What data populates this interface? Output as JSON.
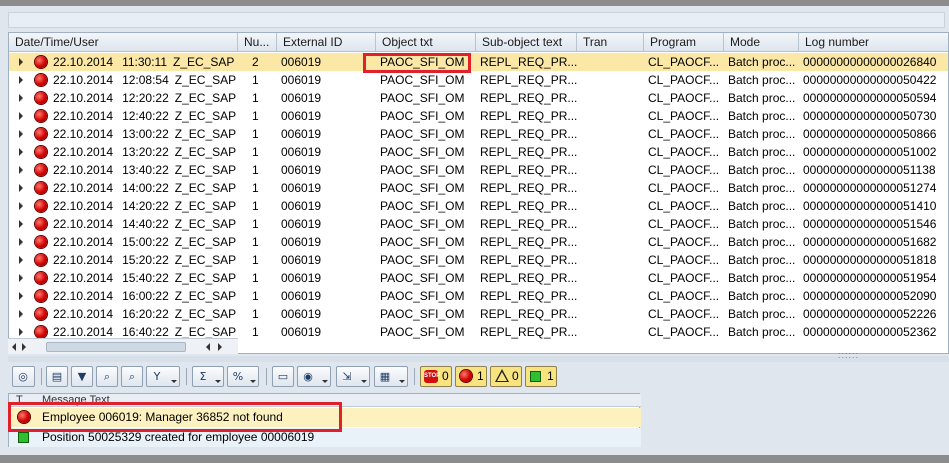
{
  "columns": {
    "datetime": "Date/Time/User",
    "num": "Nu...",
    "extid": "External ID",
    "objtxt": "Object txt",
    "subobj": "Sub-object text",
    "tran": "Tran",
    "program": "Program",
    "mode": "Mode",
    "lognum": "Log number"
  },
  "rows": [
    {
      "date": "22.10.2014",
      "time": "11:30:11",
      "user": "Z_EC_SAP",
      "num": "2",
      "extid": "006019",
      "objtxt": "PAOC_SFI_OM",
      "subobj": "REPL_REQ_PR...",
      "tran": "",
      "program": "CL_PAOCF...",
      "mode": "Batch proc...",
      "lognum": "00000000000000026840"
    },
    {
      "date": "22.10.2014",
      "time": "12:08:54",
      "user": "Z_EC_SAP",
      "num": "1",
      "extid": "006019",
      "objtxt": "PAOC_SFI_OM",
      "subobj": "REPL_REQ_PR...",
      "tran": "",
      "program": "CL_PAOCF...",
      "mode": "Batch proc...",
      "lognum": "00000000000000050422"
    },
    {
      "date": "22.10.2014",
      "time": "12:20:22",
      "user": "Z_EC_SAP",
      "num": "1",
      "extid": "006019",
      "objtxt": "PAOC_SFI_OM",
      "subobj": "REPL_REQ_PR...",
      "tran": "",
      "program": "CL_PAOCF...",
      "mode": "Batch proc...",
      "lognum": "00000000000000050594"
    },
    {
      "date": "22.10.2014",
      "time": "12:40:22",
      "user": "Z_EC_SAP",
      "num": "1",
      "extid": "006019",
      "objtxt": "PAOC_SFI_OM",
      "subobj": "REPL_REQ_PR...",
      "tran": "",
      "program": "CL_PAOCF...",
      "mode": "Batch proc...",
      "lognum": "00000000000000050730"
    },
    {
      "date": "22.10.2014",
      "time": "13:00:22",
      "user": "Z_EC_SAP",
      "num": "1",
      "extid": "006019",
      "objtxt": "PAOC_SFI_OM",
      "subobj": "REPL_REQ_PR...",
      "tran": "",
      "program": "CL_PAOCF...",
      "mode": "Batch proc...",
      "lognum": "00000000000000050866"
    },
    {
      "date": "22.10.2014",
      "time": "13:20:22",
      "user": "Z_EC_SAP",
      "num": "1",
      "extid": "006019",
      "objtxt": "PAOC_SFI_OM",
      "subobj": "REPL_REQ_PR...",
      "tran": "",
      "program": "CL_PAOCF...",
      "mode": "Batch proc...",
      "lognum": "00000000000000051002"
    },
    {
      "date": "22.10.2014",
      "time": "13:40:22",
      "user": "Z_EC_SAP",
      "num": "1",
      "extid": "006019",
      "objtxt": "PAOC_SFI_OM",
      "subobj": "REPL_REQ_PR...",
      "tran": "",
      "program": "CL_PAOCF...",
      "mode": "Batch proc...",
      "lognum": "00000000000000051138"
    },
    {
      "date": "22.10.2014",
      "time": "14:00:22",
      "user": "Z_EC_SAP",
      "num": "1",
      "extid": "006019",
      "objtxt": "PAOC_SFI_OM",
      "subobj": "REPL_REQ_PR...",
      "tran": "",
      "program": "CL_PAOCF...",
      "mode": "Batch proc...",
      "lognum": "00000000000000051274"
    },
    {
      "date": "22.10.2014",
      "time": "14:20:22",
      "user": "Z_EC_SAP",
      "num": "1",
      "extid": "006019",
      "objtxt": "PAOC_SFI_OM",
      "subobj": "REPL_REQ_PR...",
      "tran": "",
      "program": "CL_PAOCF...",
      "mode": "Batch proc...",
      "lognum": "00000000000000051410"
    },
    {
      "date": "22.10.2014",
      "time": "14:40:22",
      "user": "Z_EC_SAP",
      "num": "1",
      "extid": "006019",
      "objtxt": "PAOC_SFI_OM",
      "subobj": "REPL_REQ_PR...",
      "tran": "",
      "program": "CL_PAOCF...",
      "mode": "Batch proc...",
      "lognum": "00000000000000051546"
    },
    {
      "date": "22.10.2014",
      "time": "15:00:22",
      "user": "Z_EC_SAP",
      "num": "1",
      "extid": "006019",
      "objtxt": "PAOC_SFI_OM",
      "subobj": "REPL_REQ_PR...",
      "tran": "",
      "program": "CL_PAOCF...",
      "mode": "Batch proc...",
      "lognum": "00000000000000051682"
    },
    {
      "date": "22.10.2014",
      "time": "15:20:22",
      "user": "Z_EC_SAP",
      "num": "1",
      "extid": "006019",
      "objtxt": "PAOC_SFI_OM",
      "subobj": "REPL_REQ_PR...",
      "tran": "",
      "program": "CL_PAOCF...",
      "mode": "Batch proc...",
      "lognum": "00000000000000051818"
    },
    {
      "date": "22.10.2014",
      "time": "15:40:22",
      "user": "Z_EC_SAP",
      "num": "1",
      "extid": "006019",
      "objtxt": "PAOC_SFI_OM",
      "subobj": "REPL_REQ_PR...",
      "tran": "",
      "program": "CL_PAOCF...",
      "mode": "Batch proc...",
      "lognum": "00000000000000051954"
    },
    {
      "date": "22.10.2014",
      "time": "16:00:22",
      "user": "Z_EC_SAP",
      "num": "1",
      "extid": "006019",
      "objtxt": "PAOC_SFI_OM",
      "subobj": "REPL_REQ_PR...",
      "tran": "",
      "program": "CL_PAOCF...",
      "mode": "Batch proc...",
      "lognum": "00000000000000052090"
    },
    {
      "date": "22.10.2014",
      "time": "16:20:22",
      "user": "Z_EC_SAP",
      "num": "1",
      "extid": "006019",
      "objtxt": "PAOC_SFI_OM",
      "subobj": "REPL_REQ_PR...",
      "tran": "",
      "program": "CL_PAOCF...",
      "mode": "Batch proc...",
      "lognum": "00000000000000052226"
    },
    {
      "date": "22.10.2014",
      "time": "16:40:22",
      "user": "Z_EC_SAP",
      "num": "1",
      "extid": "006019",
      "objtxt": "PAOC_SFI_OM",
      "subobj": "REPL_REQ_PR...",
      "tran": "",
      "program": "CL_PAOCF...",
      "mode": "Batch proc...",
      "lognum": "00000000000000052362"
    }
  ],
  "toolbar": {
    "icons": [
      "glasses-icon",
      "print-icon",
      "filter-icon",
      "find-icon",
      "filter-dropdown-icon",
      "sum-icon",
      "subtotal-icon",
      "print-preview-icon",
      "export-icon",
      "change-layout-icon",
      "select-layout-icon"
    ],
    "counters": {
      "stop": "0",
      "error": "1",
      "warning": "0",
      "success": "1"
    },
    "stop_label": "STOP"
  },
  "messages": {
    "header_type": "T",
    "header_text": "Message Text",
    "items": [
      {
        "status": "error",
        "text": "Employee 006019: Manager 36852 not found"
      },
      {
        "status": "success",
        "text": "Position 50025329 created for employee 00006019"
      }
    ]
  },
  "colors": {
    "selected_row": "#fbe7a6",
    "highlight_box": "#e0202a",
    "error": "#d40000",
    "success": "#2fbf2f"
  }
}
